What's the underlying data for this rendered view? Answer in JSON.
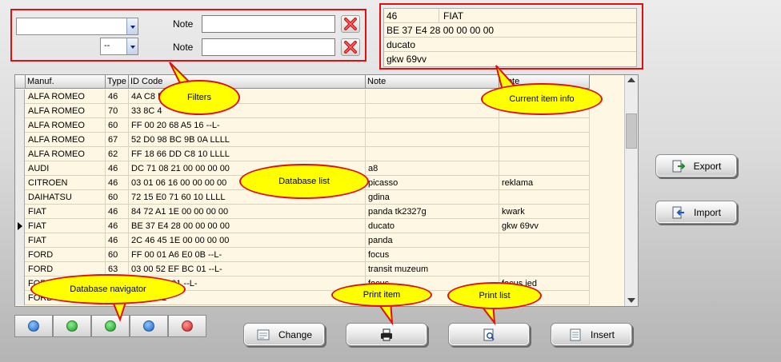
{
  "filters": {
    "combo1_value": "",
    "combo2_value": "--",
    "note_label": "Note",
    "note1_value": "",
    "note2_value": ""
  },
  "current_item": {
    "type": "46",
    "manufacturer": "FIAT",
    "id_code": "BE 37 E4 28 00 00 00 00",
    "note": "ducato",
    "note2": "gkw 69vv"
  },
  "grid": {
    "columns": [
      "Manuf.",
      "Type",
      "ID Code",
      "Note",
      "Note"
    ],
    "rows": [
      {
        "manuf": "ALFA ROMEO",
        "type": "46",
        "id": "4A C8 F",
        "note": "",
        "note2": ""
      },
      {
        "manuf": "ALFA ROMEO",
        "type": "70",
        "id": "33 8C 4",
        "note": "",
        "note2": ""
      },
      {
        "manuf": "ALFA ROMEO",
        "type": "60",
        "id": "FF 00 20 68 A5 16   --L-",
        "note": "",
        "note2": ""
      },
      {
        "manuf": "ALFA ROMEO",
        "type": "67",
        "id": "52 D0 98 BC 9B 0A   LLLL",
        "note": "",
        "note2": ""
      },
      {
        "manuf": "ALFA ROMEO",
        "type": "62",
        "id": "FF 18 66 DD C8 10   LLLL",
        "note": "",
        "note2": ""
      },
      {
        "manuf": "AUDI",
        "type": "46",
        "id": "DC 71 08 21 00 00 00 00",
        "note": "a8",
        "note2": ""
      },
      {
        "manuf": "CITROEN",
        "type": "46",
        "id": "03 01 06 16 00 00 00 00",
        "note": "picasso",
        "note2": "reklama"
      },
      {
        "manuf": "DAIHATSU",
        "type": "60",
        "id": "72 15 E0 71 60 10   LLLL",
        "note": "gdina",
        "note2": ""
      },
      {
        "manuf": "FIAT",
        "type": "46",
        "id": "84 72 A1 1E 00 00 00 00",
        "note": "panda tk2327g",
        "note2": "kwark"
      },
      {
        "manuf": "FIAT",
        "type": "46",
        "id": "BE 37 E4 28 00 00 00 00",
        "note": "ducato",
        "note2": "gkw 69vv"
      },
      {
        "manuf": "FIAT",
        "type": "46",
        "id": "2C 46 45 1E 00 00 00 00",
        "note": "panda",
        "note2": ""
      },
      {
        "manuf": "FORD",
        "type": "60",
        "id": "FF 00 01 A6 E0 0B   --L-",
        "note": "focus",
        "note2": ""
      },
      {
        "manuf": "FORD",
        "type": "63",
        "id": "03 00 52 EF BC 01   --L-",
        "note": "transit muzeum",
        "note2": ""
      },
      {
        "manuf": "FORD",
        "type": "",
        "id": "RA A9 9E 01   --L-",
        "note": "focus",
        "note2": "focus jed"
      },
      {
        "manuf": "FORD",
        "type": "",
        "id": "41 10   --L-",
        "note": "",
        "note2": ""
      }
    ]
  },
  "buttons": {
    "export": "Export",
    "import": "Import",
    "change": "Change",
    "insert": "Insert"
  },
  "callouts": {
    "filters": "Filters",
    "current_item_info": "Current item info",
    "database_list": "Database list",
    "database_navigator": "Database navigator",
    "print_item": "Print item",
    "print_list": "Print list"
  },
  "colors": {
    "annotation_red": "#e01010",
    "callout_yellow": "#ffff00",
    "grid_background": "#fdf7e4"
  }
}
